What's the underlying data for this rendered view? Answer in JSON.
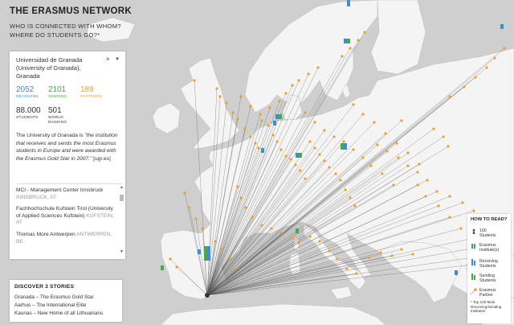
{
  "header": {
    "title": "THE ERASMUS NETWORK",
    "subtitle": "WHO IS CONNECTED WITH WHOM?\nWHERE DO STUDENTS GO?*"
  },
  "detail": {
    "name": "Universidad de Granada (University of Granada), Granada",
    "stats": {
      "receiving": {
        "value": "2052",
        "label": "RECEIVING"
      },
      "sending": {
        "value": "2101",
        "label": "SENDING"
      },
      "partners": {
        "value": "189",
        "label": "PARTNERS"
      },
      "students": {
        "value": "88.000",
        "label": "STUDENTS"
      },
      "ranking": {
        "value": "501",
        "label": "WORLD RANKING"
      }
    },
    "desc_prefix": "The University of Granada is ",
    "desc_quote": "\"the institution that receives and sends the most Erasmus students in Europe and were awarded with the Erasmus Gold Star in 2007.\"",
    "desc_source": " [ugr.es]",
    "partners_list": [
      {
        "name": "MCI - Management Center Innsbruck",
        "location": "INNSBRUCK, AT"
      },
      {
        "name": "Fachhochschule Kufstein Tirol (University of Applied Sciences Kufstein)",
        "location": "KUFSTEIN, AT"
      },
      {
        "name": "Thomas More Antwerpen",
        "location": "ANTWERPEN, BE"
      }
    ]
  },
  "stories": {
    "heading": "DISCOVER 3 STORIES",
    "items": [
      {
        "city": "Granada",
        "text": "– The Erasmus Gold Star"
      },
      {
        "city": "Aarhus",
        "text": "– The International Elite"
      },
      {
        "city": "Kaunas",
        "text": "– New Home of all Lithuanians"
      }
    ]
  },
  "legend": {
    "heading": "HOW TO READ?",
    "items": [
      {
        "icon": "person-icon",
        "label": "100\nStudents"
      },
      {
        "icon": "institution-icon",
        "label": "Erasmus\nInstitute(s)"
      },
      {
        "icon": "receiving-icon",
        "label": "Receiving\nStudents"
      },
      {
        "icon": "sending-icon",
        "label": "Sending\nStudents"
      },
      {
        "icon": "partner-icon",
        "label": "Erasmus\nPartner"
      }
    ],
    "note": "* Top 100 Most Receiving/Sending Institutes"
  },
  "colors": {
    "sea": "#cfcfcf",
    "land": "#f4f4f4",
    "border": "#bdbdbd",
    "receiving": "#3a8fd0",
    "sending": "#4aa84a",
    "partner": "#f0a020",
    "link": "#555555"
  }
}
